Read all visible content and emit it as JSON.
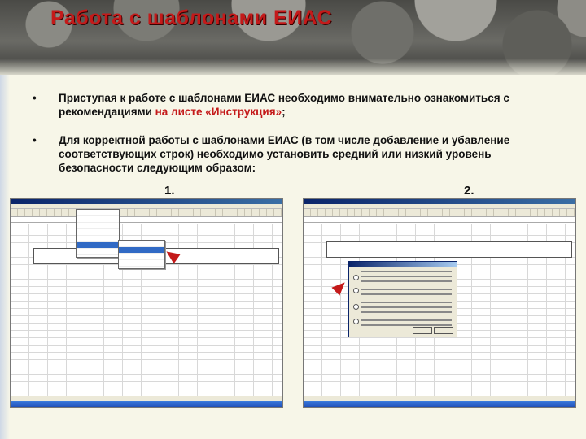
{
  "slide": {
    "title": "Работа с шаблонами ЕИАС",
    "bullet_symbol": "•",
    "bullets": [
      {
        "text_before": "Приступая к работе с шаблонами ЕИАС необходимо внимательно ознакомиться с рекомендациями ",
        "highlight": "на листе «Инструкция»",
        "text_after": ";"
      },
      {
        "text": "Для корректной работы с шаблонами ЕИАС (в том числе добавление и убавление соответствующих строк) необходимо установить средний или низкий уровень безопасности следующим образом:"
      }
    ],
    "steps": [
      "1.",
      "2."
    ],
    "colors": {
      "title": "#c41a1a",
      "highlight": "#c41a1a",
      "arrow": "#c41a1a"
    }
  },
  "screenshots": [
    {
      "name": "excel-tools-menu-screenshot",
      "icon": "excel-window"
    },
    {
      "name": "excel-security-dialog-screenshot",
      "icon": "excel-window"
    }
  ]
}
